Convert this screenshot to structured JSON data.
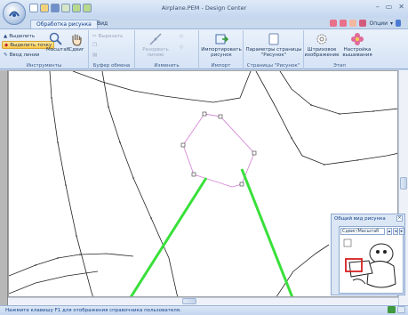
{
  "window": {
    "title": "Airplane.PEM - Design Center",
    "controls": [
      "–",
      "▭",
      "✕"
    ]
  },
  "tabs": [
    {
      "label": "Обработка рисунка",
      "active": true
    },
    {
      "label": "Вид",
      "active": false
    }
  ],
  "ribbon_right": {
    "options_label": "Опции"
  },
  "ribbon": {
    "groups": [
      {
        "label": "Инструменты"
      },
      {
        "label": "Буфер обмена"
      },
      {
        "label": "Изменить"
      },
      {
        "label": "Импорт"
      },
      {
        "label": "Страницы \"Рисунок\""
      },
      {
        "label": "Этап"
      }
    ],
    "tools": {
      "select": "Выделить",
      "select_point": "Выделить точку",
      "enter_line": "Ввод линии",
      "zoom": "Масштаб",
      "pan": "Сдвиг"
    },
    "clipboard": {
      "cut": "Вырезать"
    },
    "modify": {
      "split_line": "Разорвать линию"
    },
    "import": {
      "import_picture": "Импортировать рисунок"
    },
    "pages": {
      "page_params": "Параметры страницы \"Рисунок\""
    },
    "stage": {
      "line_image": "Штриховое изображение",
      "embroidery_settings": "Настройка вышивания"
    }
  },
  "overview": {
    "title": "Общий вид рисунка",
    "mode": "Сдвиг/Масштаб"
  },
  "status": {
    "text": "Нажмите клавишу F1 для отображения справочника пользователя."
  },
  "colors": {
    "accent": "#15428b",
    "selection": "#d68ad6",
    "arrow": "#39e03a",
    "canvas": "#ffffff"
  }
}
